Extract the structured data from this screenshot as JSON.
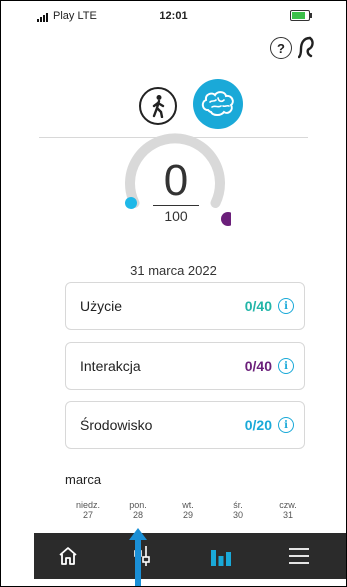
{
  "status_bar": {
    "carrier": "Play",
    "network": "LTE",
    "time": "12:01"
  },
  "header": {
    "help_label": "?"
  },
  "modes": [
    {
      "name": "activity",
      "icon": "walking-person-icon",
      "active": false
    },
    {
      "name": "brain-health",
      "icon": "brain-icon",
      "active": true
    }
  ],
  "score": {
    "value": "0",
    "max": "100",
    "progress": 0
  },
  "date": "31 marca 2022",
  "metrics": [
    {
      "label": "Użycie",
      "value": "0/40",
      "color": "#22b5a8"
    },
    {
      "label": "Interakcja",
      "value": "0/40",
      "color": "#6b1f7a"
    },
    {
      "label": "Środowisko",
      "value": "0/20",
      "color": "#1aa9d8"
    }
  ],
  "week": {
    "month": "marca",
    "days": [
      {
        "name": "niedz.",
        "num": "27"
      },
      {
        "name": "pon.",
        "num": "28"
      },
      {
        "name": "wt.",
        "num": "29"
      },
      {
        "name": "śr.",
        "num": "30"
      },
      {
        "name": "czw.",
        "num": "31"
      }
    ]
  },
  "tabs": [
    {
      "name": "home",
      "icon": "home-icon",
      "active": false
    },
    {
      "name": "adjust",
      "icon": "sliders-icon",
      "active": false
    },
    {
      "name": "stats",
      "icon": "bar-chart-icon",
      "active": true
    },
    {
      "name": "menu",
      "icon": "menu-icon",
      "active": false
    }
  ],
  "colors": {
    "accent": "#1aa9d8",
    "gauge_track": "#d9d9d9",
    "gauge_start": "#1fb8e8",
    "gauge_end": "#6b1f7a",
    "tabbar": "#2b2b2b"
  }
}
